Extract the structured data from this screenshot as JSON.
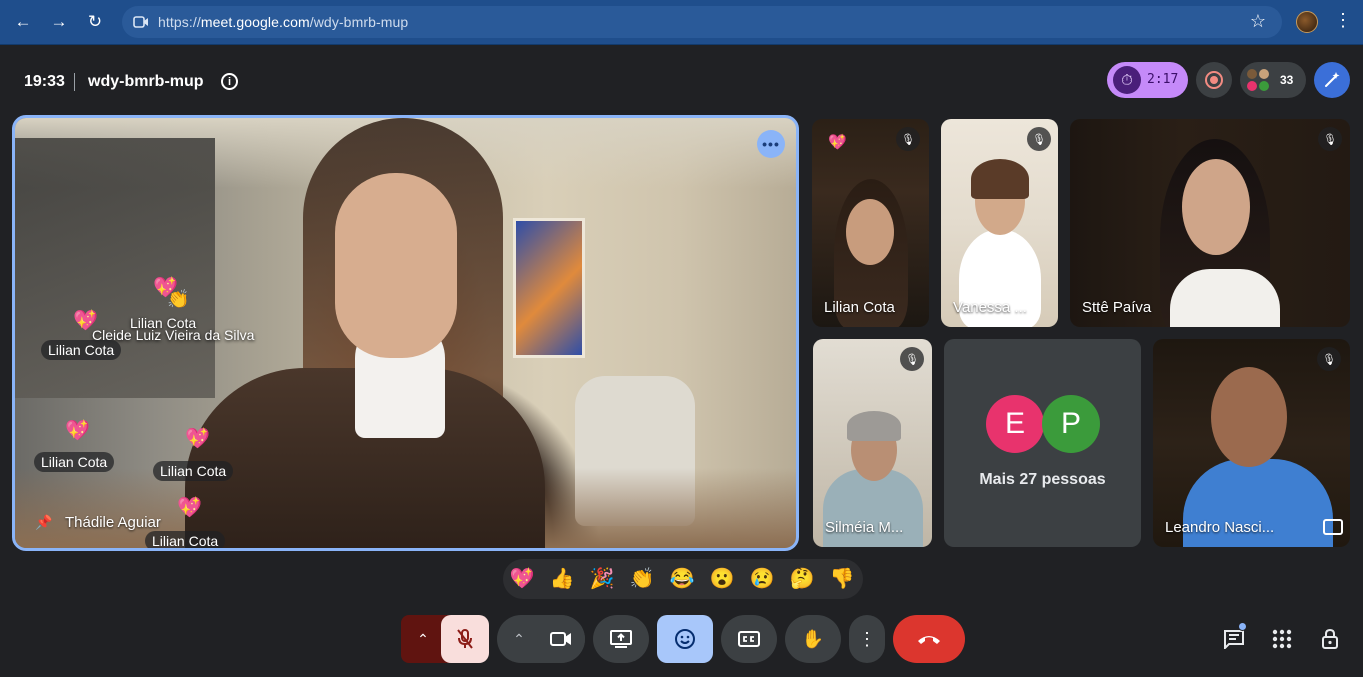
{
  "browser": {
    "url_prefix": "https://",
    "url_host": "meet.google.com",
    "url_path": "/wdy-bmrb-mup",
    "icons": [
      "back-icon",
      "forward-icon",
      "reload-icon",
      "site-info-icon",
      "bookmark-star-icon",
      "profile-avatar",
      "browser-menu-icon"
    ]
  },
  "header": {
    "time": "19:33",
    "meeting_code": "wdy-bmrb-mup",
    "timer": "2:17",
    "participant_count": "33"
  },
  "main_tile": {
    "speaker_name": "Thádile Aguiar",
    "reactions": [
      {
        "name": "Lilian Cota"
      },
      {
        "name": "Cleide Luiz Vieira da Silva"
      },
      {
        "name": "Lilian Cota"
      },
      {
        "name": "Lilian Cota"
      },
      {
        "name": "Lilian Cota"
      },
      {
        "name": "Lilian Cota"
      }
    ]
  },
  "tiles": [
    {
      "name": "Lilian Cota",
      "muted": true
    },
    {
      "name": "Vanessa ...",
      "muted": true
    },
    {
      "name": "Sttê Paíva",
      "muted": true
    },
    {
      "name": "Silméia M...",
      "muted": true
    },
    {
      "more_label": "Mais 27 pessoas",
      "avatars": [
        {
          "letter": "E",
          "color": "#e8336d"
        },
        {
          "letter": "P",
          "color": "#3b9b3b"
        }
      ]
    },
    {
      "name": "Leandro Nasci...",
      "muted": true
    }
  ],
  "reaction_bar": [
    "💖",
    "👍",
    "🎉",
    "👏",
    "😂",
    "😮",
    "😢",
    "🤔",
    "👎"
  ],
  "controls": {
    "colors": {
      "mic_off_bg": "#f9dedc",
      "mic_off_fg": "#8c1d18",
      "hangup": "#dc362e",
      "reactions_active": "#a8c7fa",
      "accent": "#8ab4f8"
    }
  }
}
